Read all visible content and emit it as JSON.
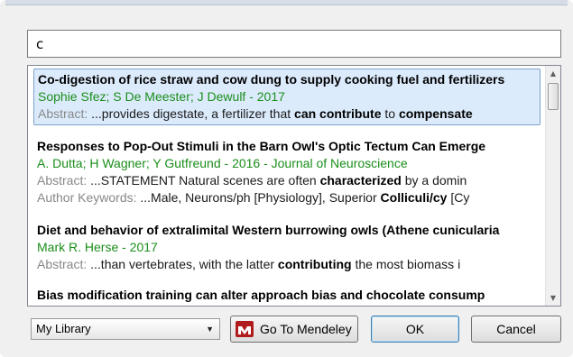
{
  "search": {
    "value": "c"
  },
  "results": [
    {
      "title": "Co-digestion of rice straw and cow dung to supply cooking fuel and fertilizers",
      "authors": "Sophie Sfez; S De Meester; J Dewulf - 2017",
      "lines": [
        {
          "label": "Abstract: ",
          "parts": [
            {
              "t": "...provides digestate, a fertilizer that ",
              "b": false
            },
            {
              "t": "can contribute",
              "b": true
            },
            {
              "t": " to ",
              "b": false
            },
            {
              "t": "compensate",
              "b": true
            }
          ]
        }
      ]
    },
    {
      "title": "Responses to Pop-Out Stimuli in the Barn Owl's Optic Tectum Can Emerge",
      "authors": "A. Dutta; H Wagner; Y Gutfreund - 2016 - Journal of Neuroscience",
      "lines": [
        {
          "label": "Abstract: ",
          "parts": [
            {
              "t": "...STATEMENT Natural scenes are often ",
              "b": false
            },
            {
              "t": "characterized",
              "b": true
            },
            {
              "t": " by a domin",
              "b": false
            }
          ]
        },
        {
          "label": "Author Keywords: ",
          "parts": [
            {
              "t": "...Male, Neurons/ph [Physiology], Superior ",
              "b": false
            },
            {
              "t": "Colliculi/cy",
              "b": true
            },
            {
              "t": " [Cy",
              "b": false
            }
          ]
        }
      ]
    },
    {
      "title": "Diet and behavior of extralimital Western burrowing owls (Athene cunicularia",
      "authors": "Mark R. Herse - 2017",
      "lines": [
        {
          "label": "Abstract: ",
          "parts": [
            {
              "t": "...than vertebrates, with the latter ",
              "b": false
            },
            {
              "t": "contributing",
              "b": true
            },
            {
              "t": " the most biomass i",
              "b": false
            }
          ]
        }
      ]
    },
    {
      "title": "Bias modification training can alter approach bias and chocolate consump",
      "authors": "",
      "lines": []
    }
  ],
  "footer": {
    "library_select": "My Library",
    "goto_mendeley": "Go To Mendeley",
    "ok": "OK",
    "cancel": "Cancel"
  },
  "colors": {
    "author_green": "#1b8e1b",
    "selection": "#dcebfc"
  }
}
